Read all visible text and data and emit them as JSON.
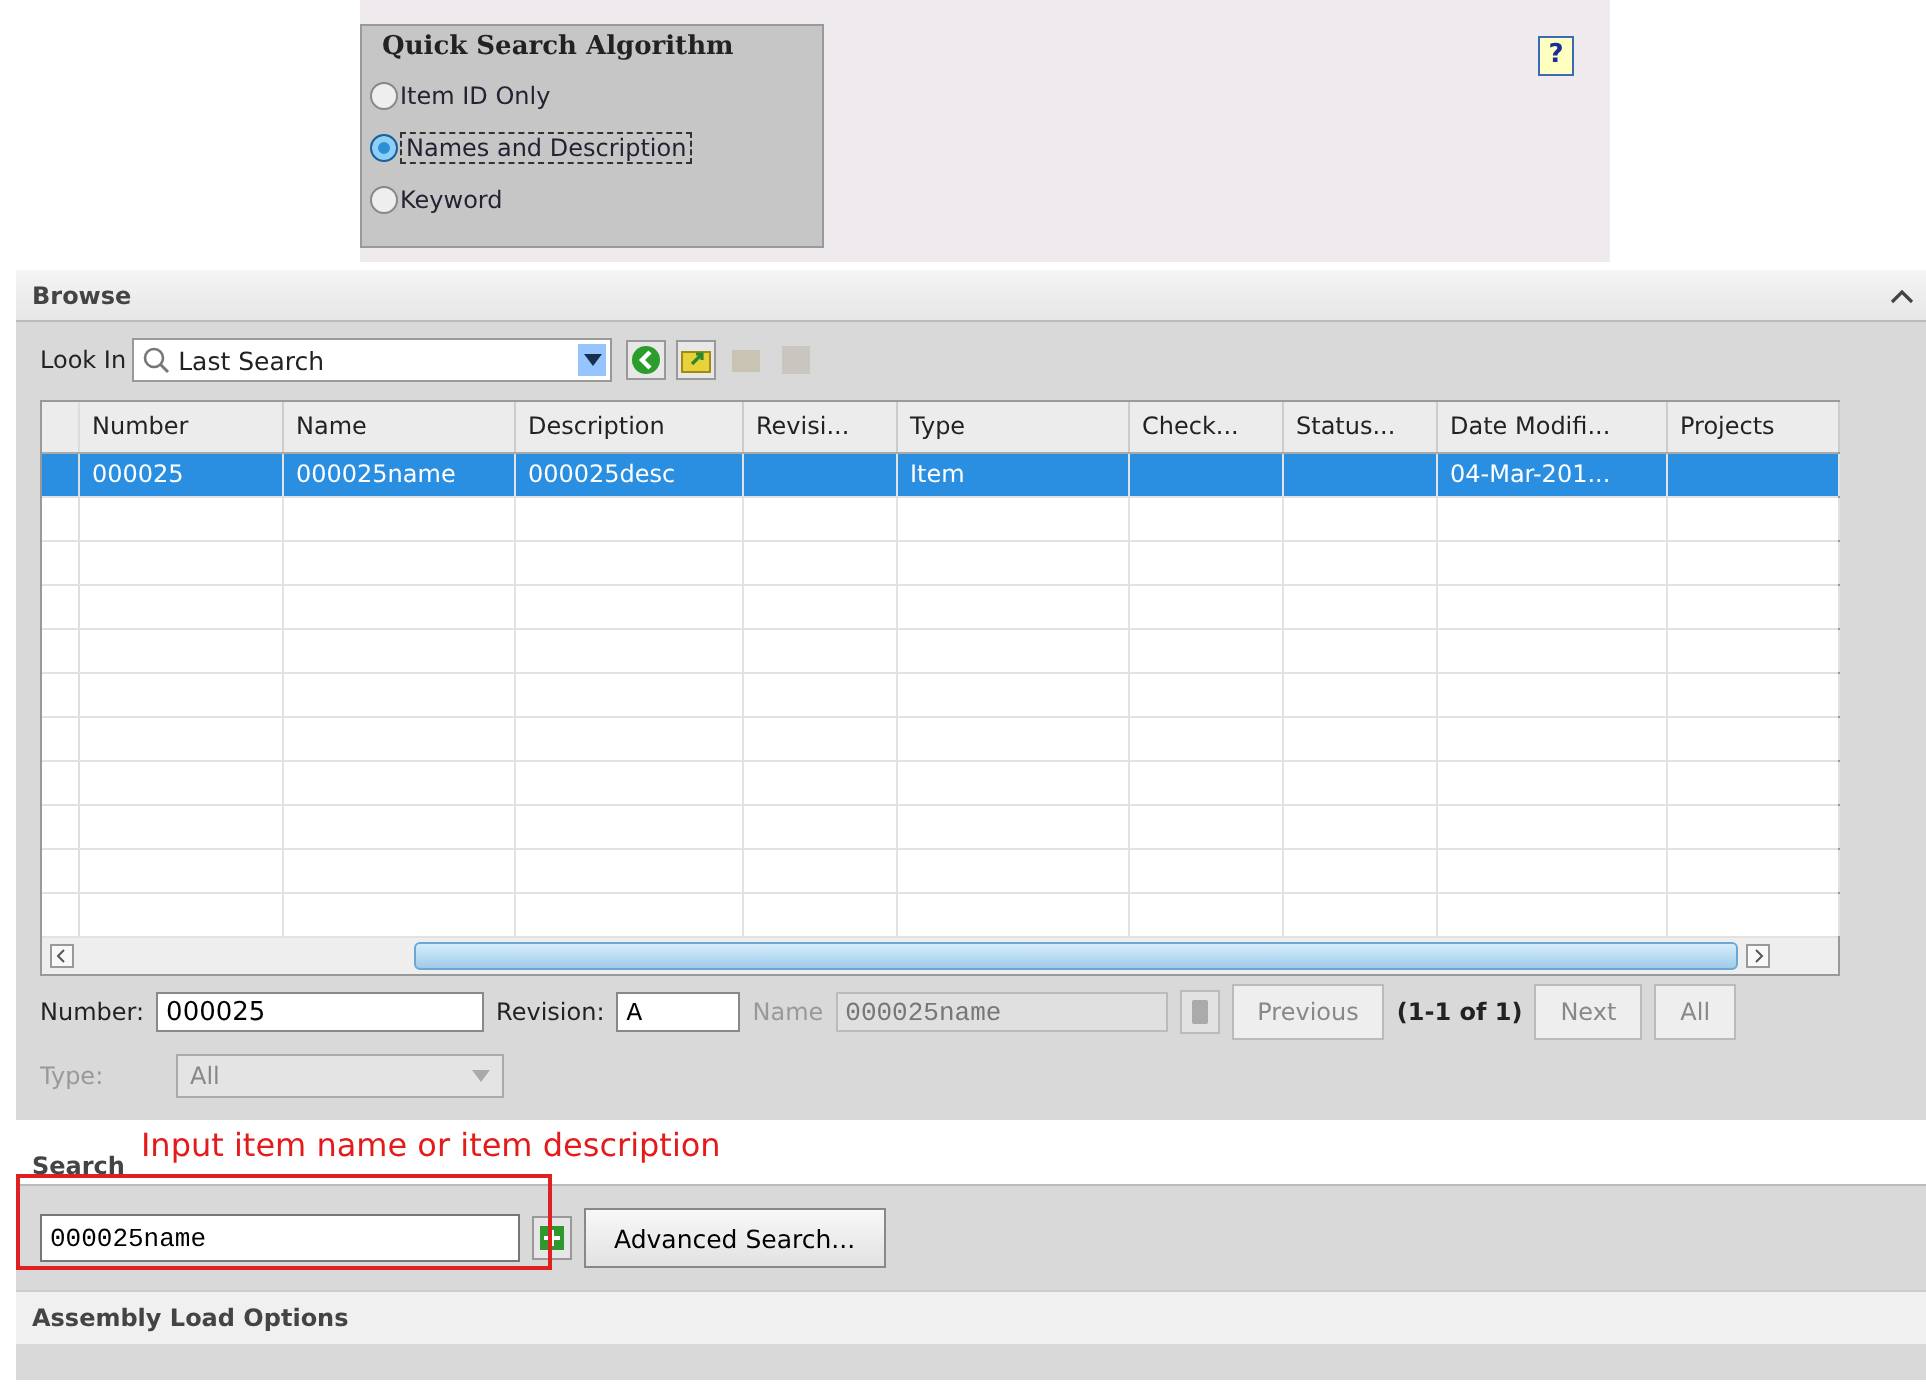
{
  "quick_search": {
    "title": "Quick Search Algorithm",
    "options": [
      {
        "label": "Item ID Only",
        "selected": false
      },
      {
        "label": "Names and Description",
        "selected": true
      },
      {
        "label": "Keyword",
        "selected": false
      }
    ],
    "help": "?"
  },
  "browse": {
    "title": "Browse",
    "look_in_label": "Look In",
    "look_in_value": "Last Search",
    "table": {
      "columns": [
        "Number",
        "Name",
        "Description",
        "Revisi...",
        "Type",
        "Check...",
        "Status...",
        "Date Modifi...",
        "Projects"
      ],
      "rows": [
        {
          "cells": [
            "000025",
            "000025name",
            "000025desc",
            "",
            "Item",
            "",
            "",
            "04-Mar-201...",
            ""
          ],
          "selected": true
        }
      ]
    },
    "fields": [
      {
        "label": "Number:",
        "value": "000025",
        "disabled": false
      },
      {
        "label": "Revision:",
        "value": "A",
        "disabled": false
      },
      {
        "label": "Name",
        "value": "000025name",
        "disabled": true
      }
    ],
    "previous": {
      "label": "Previous",
      "disabled": true
    },
    "count": "(1-1 of 1)",
    "next": {
      "label": "Next",
      "disabled": true
    },
    "all": {
      "label": "All",
      "disabled": true
    },
    "type": {
      "label": "Type:",
      "value": "All",
      "disabled": true
    }
  },
  "search": {
    "title": "Search",
    "annotation": "Input item name or item description",
    "value": "000025name",
    "advanced": "Advanced Search..."
  },
  "assembly": {
    "title": "Assembly Load Options"
  }
}
